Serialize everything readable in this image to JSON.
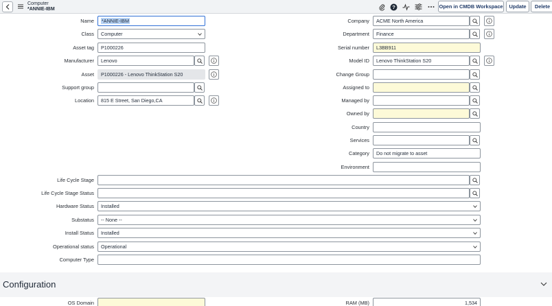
{
  "header": {
    "title": "Computer",
    "subtitle": "*ANNIE-IBM",
    "buttons": {
      "cmdb": "Open in CMDB Workspace",
      "update": "Update",
      "delete": "Delete"
    }
  },
  "form": {
    "name": {
      "label": "Name",
      "value": "*ANNIE-IBM"
    },
    "class": {
      "label": "Class",
      "value": "Computer"
    },
    "asset_tag": {
      "label": "Asset tag",
      "value": "P1000226"
    },
    "manufacturer": {
      "label": "Manufacturer",
      "value": "Lenovo"
    },
    "asset": {
      "label": "Asset",
      "value": "P1000226 - Lenovo ThinkStation S20"
    },
    "support_group": {
      "label": "Support group",
      "value": ""
    },
    "location": {
      "label": "Location",
      "value": "815 E Street, San Diego,CA"
    },
    "company": {
      "label": "Company",
      "value": "ACME North America"
    },
    "department": {
      "label": "Department",
      "value": "Finance"
    },
    "serial_number": {
      "label": "Serial number",
      "value": "L3BB911"
    },
    "model_id": {
      "label": "Model ID",
      "value": "Lenovo ThinkStation S20"
    },
    "change_group": {
      "label": "Change Group",
      "value": ""
    },
    "assigned_to": {
      "label": "Assigned to",
      "value": ""
    },
    "managed_by": {
      "label": "Managed by",
      "value": ""
    },
    "owned_by": {
      "label": "Owned by",
      "value": ""
    },
    "country": {
      "label": "Country",
      "value": ""
    },
    "services": {
      "label": "Services",
      "value": ""
    },
    "category": {
      "label": "Category",
      "value": "Do not migrate to asset"
    },
    "environment": {
      "label": "Environment",
      "value": ""
    },
    "life_cycle_stage": {
      "label": "Life Cycle Stage",
      "value": ""
    },
    "life_cycle_stage_status": {
      "label": "Life Cycle Stage Status",
      "value": ""
    },
    "hardware_status": {
      "label": "Hardware Status",
      "value": "Installed"
    },
    "substatus": {
      "label": "Substatus",
      "value": "-- None --"
    },
    "install_status": {
      "label": "Install Status",
      "value": "Installed"
    },
    "operational_status": {
      "label": "Operational status",
      "value": "Operational"
    },
    "computer_type": {
      "label": "Computer Type",
      "value": ""
    }
  },
  "configuration": {
    "title": "Configuration",
    "os_domain": {
      "label": "OS Domain",
      "value": ""
    },
    "ram": {
      "label": "RAM (MB)",
      "value": "1,534"
    }
  },
  "colors": {
    "accent": "#2f6fd6",
    "mandatory": "#fdfad8",
    "readonly": "#e4e6e9",
    "header": "#f1f3f5"
  },
  "icons": [
    "back-icon",
    "hamburger-icon",
    "paperclip-icon",
    "help-icon",
    "activity-icon",
    "settings-icon",
    "more-icon",
    "search-icon",
    "info-icon",
    "chevron-down-icon"
  ]
}
